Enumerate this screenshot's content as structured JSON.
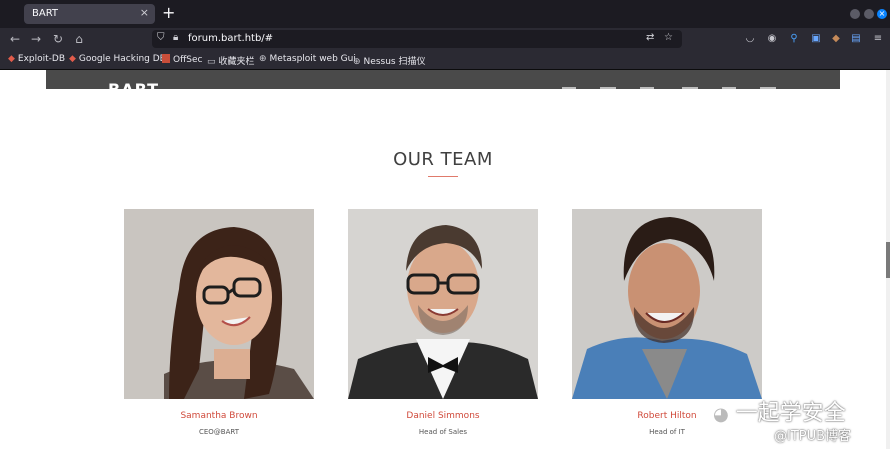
{
  "browser": {
    "tab_title": "BART",
    "tab_close": "×",
    "new_tab": "+",
    "url": "forum.bart.htb/#"
  },
  "bookmarks": [
    {
      "label": "Exploit-DB",
      "icon": "exploit-db-icon"
    },
    {
      "label": "Google Hacking DB",
      "icon": "google-hacking-db-icon"
    },
    {
      "label": "OffSec",
      "icon": "offsec-icon"
    },
    {
      "label": "收藏夹栏",
      "icon": "folder-icon"
    },
    {
      "label": "Metasploit web Gui",
      "icon": "globe-icon"
    },
    {
      "label": "Nessus 扫描仪",
      "icon": "globe-icon"
    }
  ],
  "site": {
    "brand": "BART"
  },
  "team": {
    "heading": "OUR TEAM",
    "members": [
      {
        "name": "Samantha Brown",
        "role": "CEO@BART"
      },
      {
        "name": "Daniel Simmons",
        "role": "Head of Sales"
      },
      {
        "name": "Robert Hilton",
        "role": "Head of IT"
      }
    ]
  },
  "watermark": {
    "wechat": "一起学安全",
    "itpub": "@ITPUB博客"
  },
  "colors": {
    "accent": "#d04a3b",
    "browser_bg": "#1c1b22",
    "toolbar_bg": "#2b2a33",
    "header_bg": "#4a4a4a"
  }
}
